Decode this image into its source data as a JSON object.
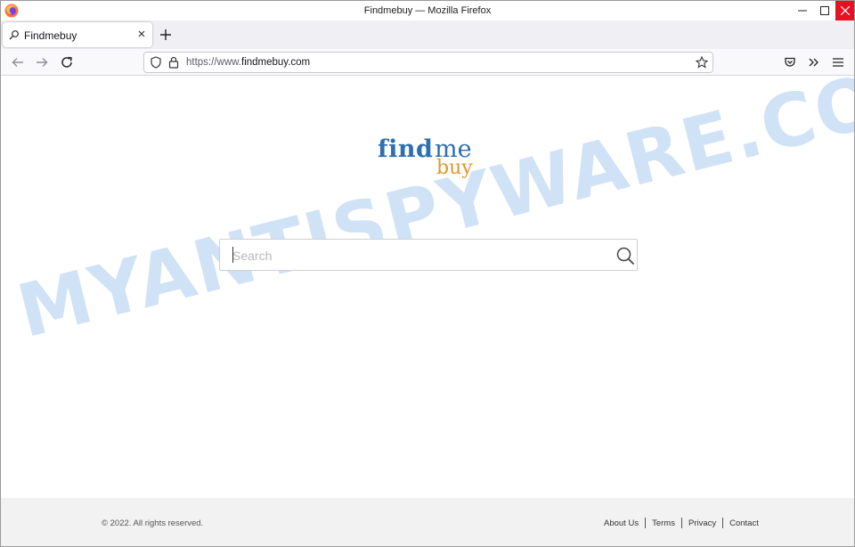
{
  "window": {
    "title": "Findmebuy — Mozilla Firefox"
  },
  "tabs": [
    {
      "label": "Findmebuy"
    }
  ],
  "navbar": {
    "url_prefix": "https://www.",
    "url_domain": "findmebuy.com"
  },
  "logo": {
    "word1": "find",
    "word2": "me",
    "word3": "buy"
  },
  "search": {
    "placeholder": "Search",
    "value": ""
  },
  "watermark": "MYANTISPYWARE.COM",
  "footer": {
    "copyright": "© 2022. All rights reserved.",
    "links": [
      "About Us",
      "Terms",
      "Privacy",
      "Contact"
    ]
  },
  "colors": {
    "brand_blue": "#2d6fb1",
    "brand_orange": "#e0962b",
    "close_red": "#e81123"
  }
}
